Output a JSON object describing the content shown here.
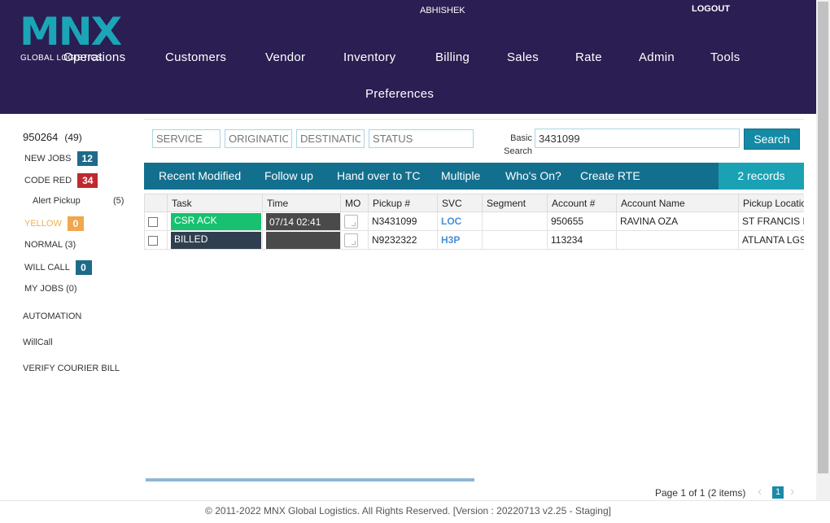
{
  "header": {
    "logo_text": "MNX",
    "logo_sub": "GLOBAL LOGISTICS",
    "user": "ABHISHEK",
    "logout": "LOGOUT",
    "nav": [
      "Operations",
      "Customers",
      "Vendor",
      "Inventory",
      "Billing",
      "Sales",
      "Rate",
      "Admin",
      "Tools",
      "Preferences"
    ]
  },
  "sidebar": {
    "id": "950264",
    "id_count": "(49)",
    "items": [
      {
        "label": "NEW JOBS",
        "badge": "12"
      },
      {
        "label": "CODE RED",
        "badge": "34"
      },
      {
        "label": "Alert Pickup",
        "count": "(5)"
      },
      {
        "label": "YELLOW",
        "badge": "0"
      },
      {
        "label": "NORMAL (3)"
      },
      {
        "label": "WILL CALL",
        "badge": "0"
      },
      {
        "label": "MY JOBS (0)"
      }
    ],
    "links": [
      "AUTOMATION",
      "WillCall",
      "VERIFY COURIER BILL"
    ]
  },
  "filters": {
    "service": "SERVICE",
    "origination": "ORIGINATION",
    "destination": "DESTINATION",
    "status": "STATUS",
    "basic_label": "Basic Search",
    "search_value": "3431099",
    "search_button": "Search"
  },
  "tabs": [
    "Recent Modified",
    "Follow up",
    "Hand over to TC",
    "Multiple",
    "Who's On?",
    "Create RTE"
  ],
  "records": "2 records",
  "table": {
    "columns": [
      "Task",
      "Time",
      "MO",
      "Pickup #",
      "SVC",
      "Segment",
      "Account #",
      "Account Name",
      "Pickup Location"
    ],
    "rows": [
      {
        "task": "CSR ACK",
        "time": "07/14 02:41",
        "pickup": "N3431099",
        "svc": "LOC",
        "segment": "",
        "account": "950655",
        "account_name": "RAVINA OZA",
        "location": "ST FRANCIS M"
      },
      {
        "task": "BILLED",
        "time": "",
        "pickup": "N9232322",
        "svc": "H3P",
        "segment": "",
        "account": "113234",
        "account_name": "",
        "location": "ATLANTA LGS"
      }
    ]
  },
  "colors": {
    "header_bg": "#2a1e52",
    "accent": "#138aa6",
    "task_green": "#17c16f",
    "task_dark": "#2f3f4f"
  },
  "pager": {
    "text": "Page 1 of 1 (2 items)",
    "current": "1"
  },
  "footer": "© 2011-2022 MNX Global Logistics. All Rights Reserved. [Version : 20220713 v2.25 - Staging]"
}
